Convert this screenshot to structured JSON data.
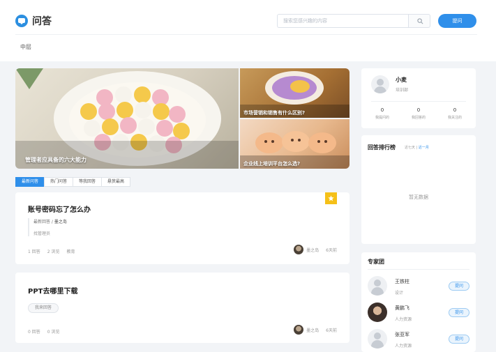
{
  "header": {
    "brand_title": "问答",
    "search_placeholder": "搜索您感兴趣的内容",
    "ask_label": "提问",
    "breadcrumb": "中层"
  },
  "hero": {
    "main_caption": "管理者应具备的六大能力",
    "side_captions": [
      "市场营销和销售有什么区别?",
      "企业线上培训平台怎么选?"
    ]
  },
  "tabs": [
    "最新问答",
    "热门问答",
    "等我回答",
    "悬赏最高"
  ],
  "questions": [
    {
      "title": "账号密码忘了怎么办",
      "latest_label": "最新回答 /",
      "latest_author": "墨之岛",
      "answer_text": "找管理员",
      "stats": [
        "1 回答",
        "2 浏览",
        "教育"
      ],
      "author": "墨之岛",
      "time": "6天前"
    },
    {
      "title": "PPT去哪里下载",
      "button_label": "我来回答",
      "stats": [
        "0 回答",
        "0 浏览"
      ],
      "author": "墨之岛",
      "time": "6天前"
    }
  ],
  "profile": {
    "name": "小麦",
    "dept": "培训部",
    "stats": [
      {
        "value": "0",
        "label": "我提问的"
      },
      {
        "value": "0",
        "label": "我回答的"
      },
      {
        "value": "0",
        "label": "我关注的"
      }
    ]
  },
  "ranking": {
    "title": "回答排行榜",
    "filter_week": "近七天",
    "filter_sep": "|",
    "filter_month": "近一月",
    "empty_text": "暂无数据"
  },
  "experts": {
    "title": "专家团",
    "items": [
      {
        "name": "王铁柱",
        "dept": "设计",
        "button": "提问"
      },
      {
        "name": "黄鹏飞",
        "dept": "人力资源",
        "button": "提问"
      },
      {
        "name": "张亚军",
        "dept": "人力资源",
        "button": "提问"
      }
    ]
  }
}
